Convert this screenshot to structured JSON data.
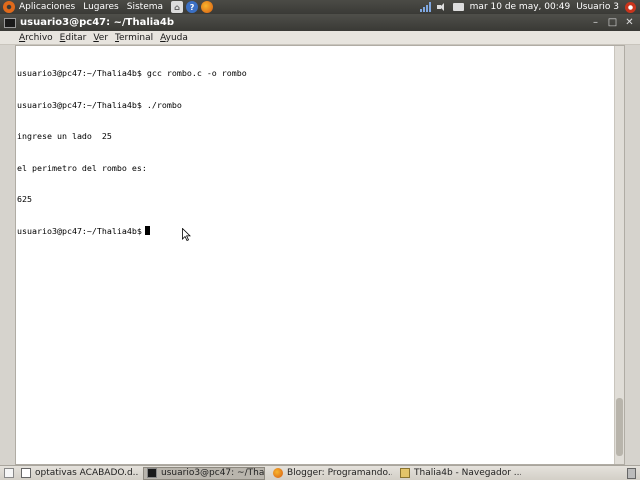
{
  "top_panel": {
    "menus": [
      "Aplicaciones",
      "Lugares",
      "Sistema"
    ],
    "clock": "mar 10 de may, 00:49",
    "user": "Usuario 3"
  },
  "window": {
    "title": "usuario3@pc47: ~/Thalia4b",
    "menu": [
      "Archivo",
      "Editar",
      "Ver",
      "Terminal",
      "Ayuda"
    ],
    "controls": [
      "–",
      "□",
      "✕"
    ]
  },
  "terminal": {
    "lines": [
      "usuario3@pc47:~/Thalia4b$ gcc rombo.c -o rombo",
      "usuario3@pc47:~/Thalia4b$ ./rombo",
      "ingrese un lado  25",
      "el perimetro del rombo es:",
      "625",
      "usuario3@pc47:~/Thalia4b$"
    ]
  },
  "taskbar": {
    "tasks": [
      "optativas ACABADO.d...",
      "usuario3@pc47: ~/Tha...",
      "Blogger: Programando...",
      "Thalia4b - Navegador ..."
    ]
  },
  "colors": {
    "panel": "#3a3a36",
    "terminal_bg": "#ffffff",
    "accent": "#e06a1b"
  }
}
